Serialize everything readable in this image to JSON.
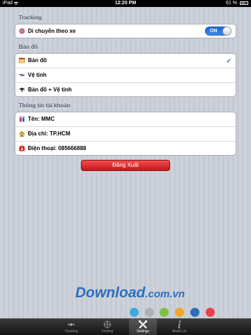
{
  "status_bar": {
    "carrier": "iPad",
    "time": "12:20 PM",
    "battery": "61 %"
  },
  "sections": {
    "tracking": {
      "header": "Tracking",
      "rows": [
        {
          "label": "Di chuyển theo xe",
          "toggle": "ON",
          "icon": "car-icon"
        }
      ]
    },
    "map": {
      "header": "Bản đồ",
      "rows": [
        {
          "label": "Bản đồ",
          "icon": "map-icon",
          "selected": true,
          "check": "✓"
        },
        {
          "label": "Vệ tinh",
          "icon": "satellite-icon"
        },
        {
          "label": "Bản đồ + Vệ tinh",
          "icon": "hybrid-icon"
        }
      ]
    },
    "account": {
      "header": "Thông tin tài khoản",
      "rows": [
        {
          "label": "Tên: MMC",
          "icon": "user-icon"
        },
        {
          "label": "Địa chỉ: TP.HCM",
          "icon": "address-icon"
        },
        {
          "label": "Điện thoại: 085666888",
          "icon": "phone-icon"
        }
      ]
    }
  },
  "logout_label": "Đăng Xuất",
  "watermark": {
    "text": "Download",
    "suffix": ".com.vn",
    "dot_colors": [
      "#3fa9e0",
      "#b0b0b0",
      "#7cc242",
      "#f5a623",
      "#2a6fbf",
      "#e9414a"
    ]
  },
  "tabbar": {
    "tabs": [
      {
        "label": "Tracking",
        "icon": "satellite-dish-icon",
        "selected": false
      },
      {
        "label": "Finding",
        "icon": "crosshair-icon",
        "selected": false
      },
      {
        "label": "Settings",
        "icon": "wrench-icon",
        "selected": true
      },
      {
        "label": "About Us",
        "icon": "info-icon",
        "selected": false
      }
    ]
  },
  "colors": {
    "accent": "#1a63d9",
    "logout": "#c4161c",
    "tabbar": "#111111"
  }
}
